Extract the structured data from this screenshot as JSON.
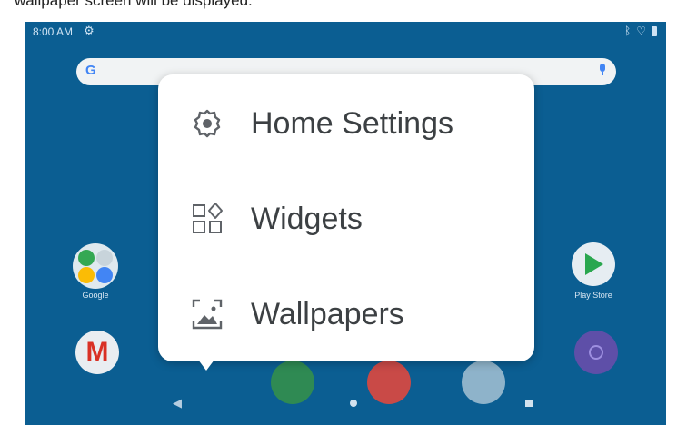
{
  "caption": "wallpaper screen will be displayed.",
  "status": {
    "time": "8:00 AM",
    "icons": [
      "gear-icon",
      "bluetooth-icon",
      "wifi-icon",
      "battery-icon"
    ]
  },
  "search": {
    "logo": "G"
  },
  "apps": {
    "google_label": "Google",
    "play_store_label": "Play Store"
  },
  "menu": {
    "items": [
      {
        "label": "Home Settings",
        "icon": "settings-gear-icon"
      },
      {
        "label": "Widgets",
        "icon": "widgets-icon"
      },
      {
        "label": "Wallpapers",
        "icon": "wallpaper-icon"
      }
    ]
  },
  "navigation": {
    "buttons": [
      "back",
      "home",
      "recents"
    ]
  },
  "colors": {
    "wallpaper": "#0b5e92",
    "menu_bg": "#ffffff",
    "menu_text": "#3c4043",
    "icon_gray": "#5f6368"
  }
}
